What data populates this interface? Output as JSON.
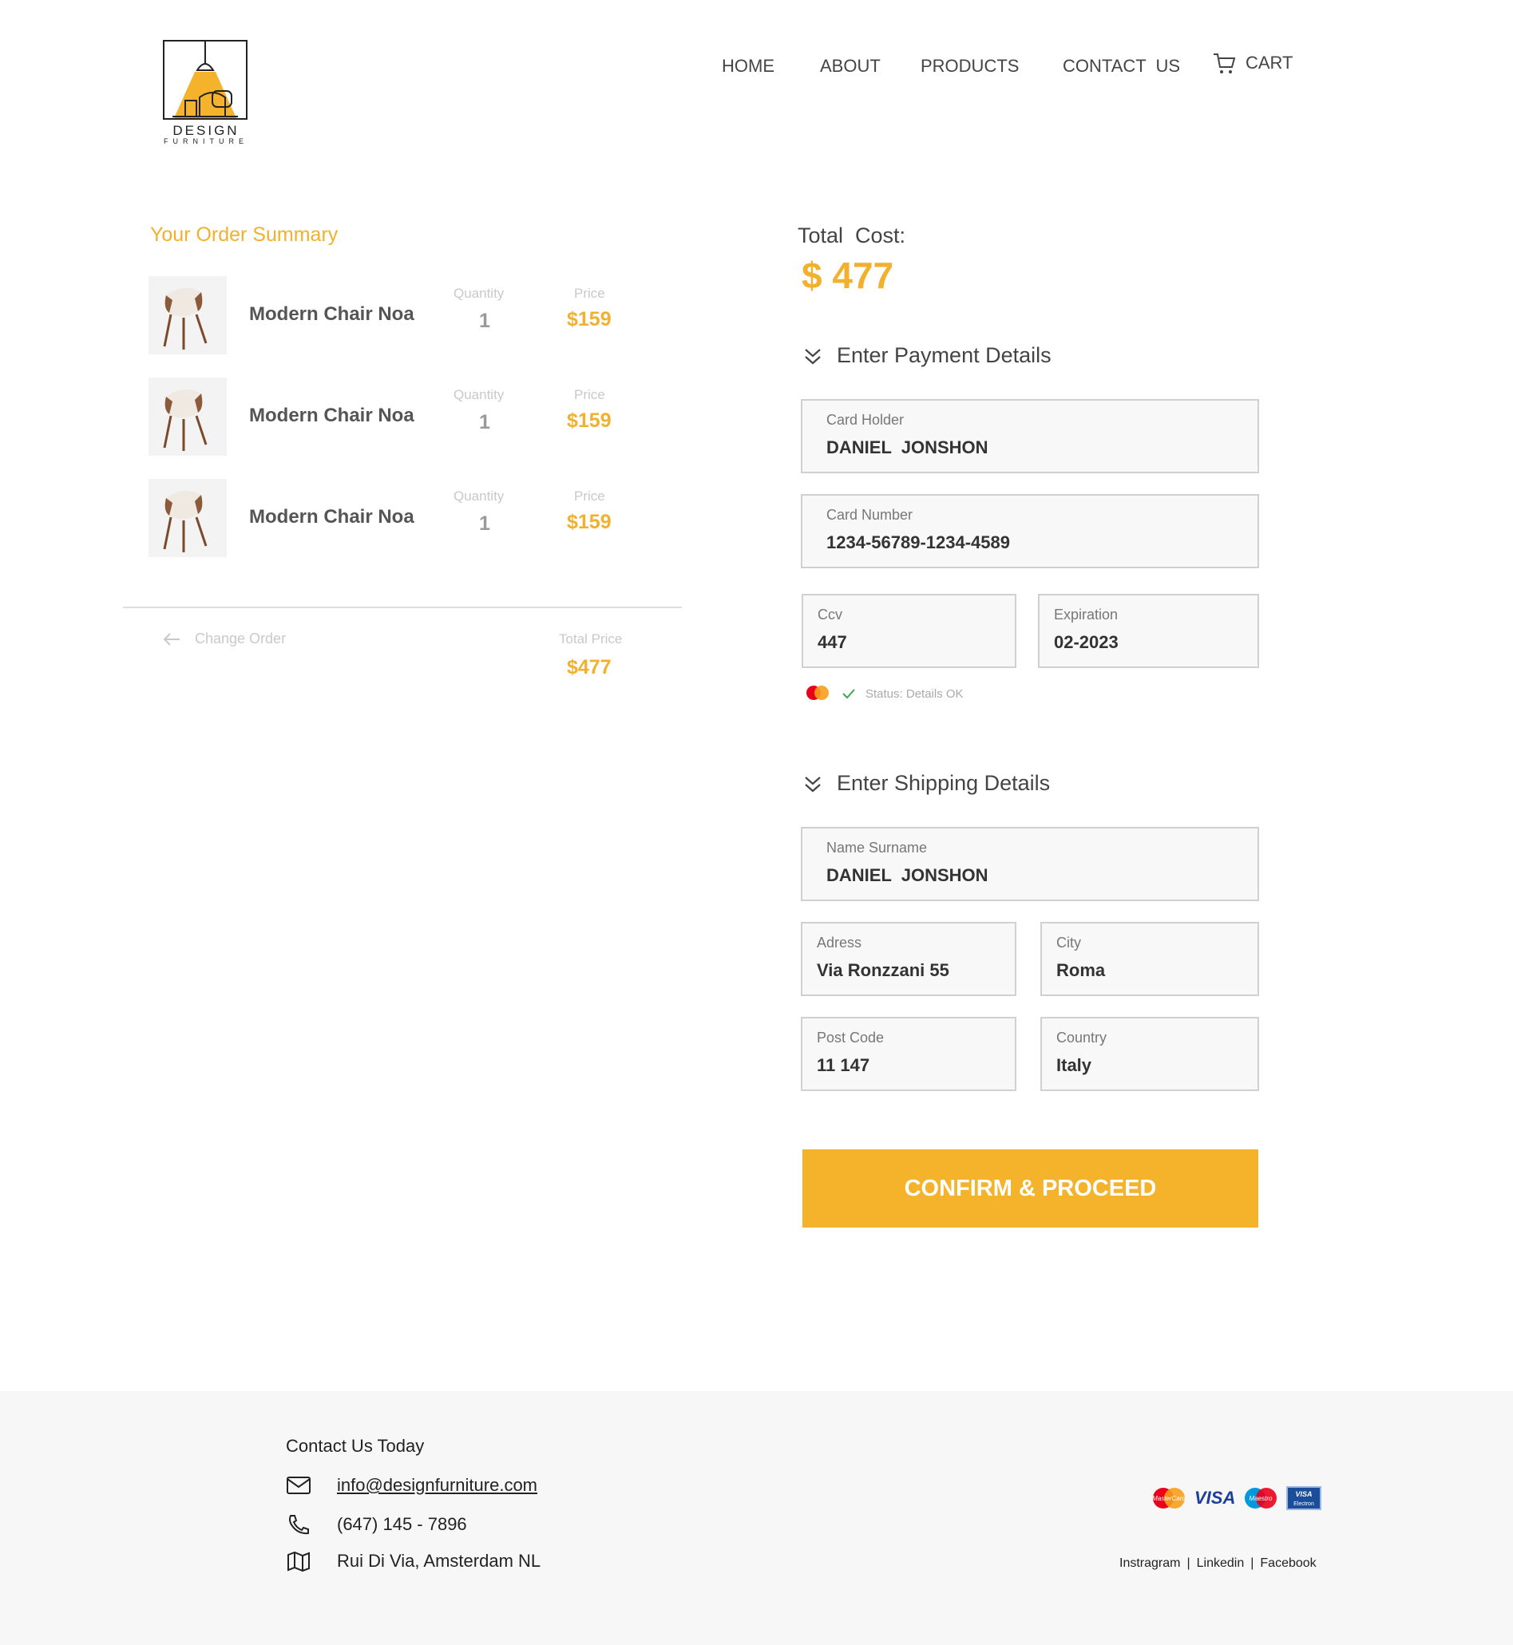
{
  "header": {
    "logo_line1": "DESIGN",
    "logo_line2": "FURNITURE",
    "nav": {
      "home": "HOME",
      "about": "ABOUT",
      "products": "PRODUCTS",
      "contact": "CONTACT  US",
      "cart": "CART"
    }
  },
  "order_summary": {
    "title": "Your Order Summary",
    "items": [
      {
        "name": "Modern Chair Noa",
        "quantity_label": "Quantity",
        "quantity": "1",
        "price_label": "Price",
        "price": "$159"
      },
      {
        "name": "Modern Chair Noa",
        "quantity_label": "Quantity",
        "quantity": "1",
        "price_label": "Price",
        "price": "$159"
      },
      {
        "name": "Modern Chair Noa",
        "quantity_label": "Quantity",
        "quantity": "1",
        "price_label": "Price",
        "price": "$159"
      }
    ],
    "change_order": "Change Order",
    "total_price_label": "Total Price",
    "total_price": "$477"
  },
  "payment": {
    "total_cost_label": "Total  Cost:",
    "total_cost": "$ 477",
    "section_title": "Enter Payment Details",
    "card_holder_label": "Card Holder",
    "card_holder": "DANIEL  JONSHON",
    "card_number_label": "Card Number",
    "card_number": "1234-56789-1234-4589",
    "ccv_label": "Ccv",
    "ccv": "447",
    "expiration_label": "Expiration",
    "expiration": "02-2023",
    "status": "Status: Details OK"
  },
  "shipping": {
    "section_title": "Enter Shipping Details",
    "name_label": "Name Surname",
    "name": "DANIEL  JONSHON",
    "address_label": "Adress",
    "address": "Via Ronzzani 55",
    "city_label": "City",
    "city": "Roma",
    "postcode_label": "Post Code",
    "postcode": "11 147",
    "country_label": "Country",
    "country": "Italy"
  },
  "confirm_button": "CONFIRM & PROCEED",
  "footer": {
    "title": "Contact Us Today",
    "email": "info@designfurniture.com",
    "phone": "(647) 145 - 7896",
    "address": "Rui Di Via, Amsterdam NL",
    "social": {
      "instagram": "Instragram",
      "linkedin": "Linkedin",
      "facebook": "Facebook"
    },
    "cards": {
      "mastercard": "MasterCard",
      "visa": "VISA",
      "maestro": "Maestro",
      "visa_electron_1": "VISA",
      "visa_electron_2": "Electron"
    }
  },
  "colors": {
    "accent": "#f4b32b",
    "footer_bg": "#f8f7f7",
    "field_bg": "#f8f8f8"
  }
}
